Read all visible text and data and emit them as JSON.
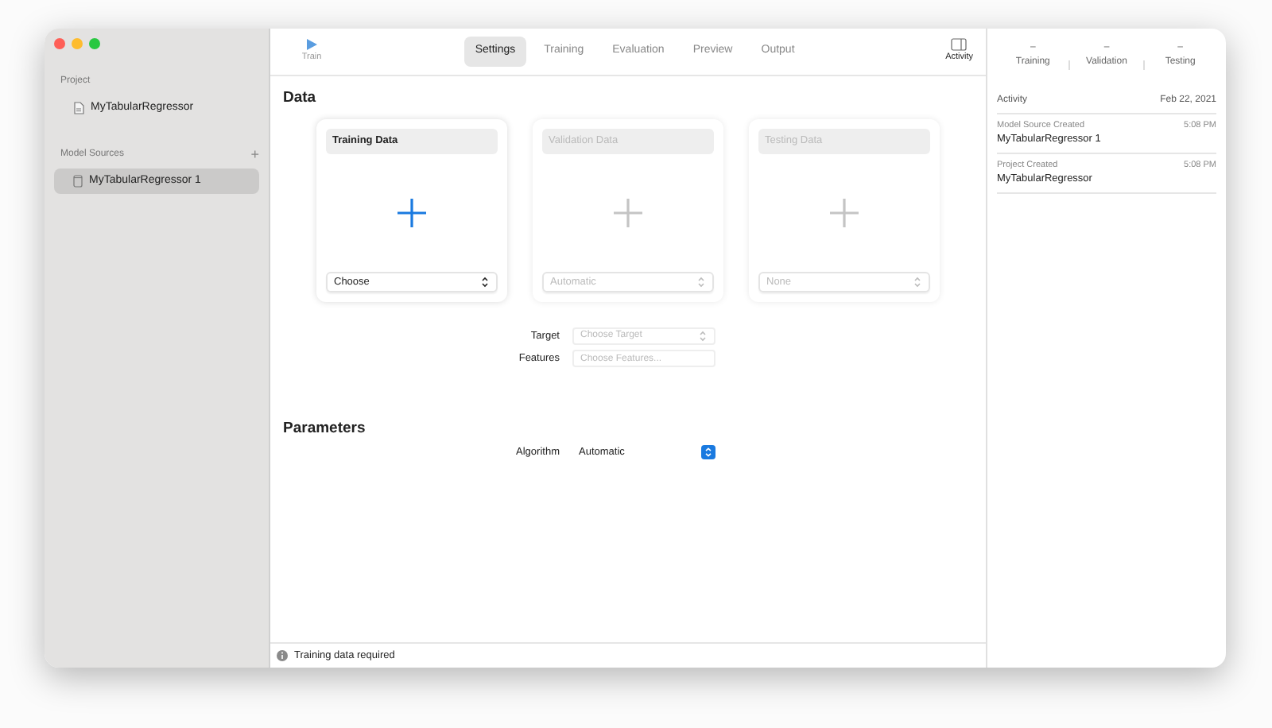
{
  "sidebar": {
    "sections": [
      {
        "title": "Project",
        "items": [
          {
            "label": "MyTabularRegressor",
            "kind": "project",
            "selected": false
          }
        ]
      },
      {
        "title": "Model Sources",
        "add_button": "+",
        "items": [
          {
            "label": "MyTabularRegressor 1",
            "kind": "source",
            "selected": true
          }
        ]
      }
    ]
  },
  "toolbar": {
    "train_button": {
      "label": "Train"
    },
    "tabs": [
      {
        "label": "Settings",
        "selected": true
      },
      {
        "label": "Training",
        "selected": false
      },
      {
        "label": "Evaluation",
        "selected": false
      },
      {
        "label": "Preview",
        "selected": false
      },
      {
        "label": "Output",
        "selected": false
      }
    ],
    "activity_button": {
      "label": "Activity"
    }
  },
  "data": {
    "title": "Data",
    "cards": [
      {
        "title": "Training Data",
        "enabled": true,
        "dropdown": "Choose"
      },
      {
        "title": "Validation Data",
        "enabled": false,
        "dropdown": "Automatic"
      },
      {
        "title": "Testing Data",
        "enabled": false,
        "dropdown": "None"
      }
    ],
    "fields": [
      {
        "label": "Target",
        "kind": "popup",
        "placeholder": "Choose Target"
      },
      {
        "label": "Features",
        "kind": "tokens",
        "placeholder": "Choose Features..."
      }
    ]
  },
  "parameters": {
    "title": "Parameters",
    "rows": [
      {
        "label": "Algorithm",
        "value": "Automatic"
      }
    ]
  },
  "status_bar": {
    "text": "Training data required"
  },
  "inspector": {
    "counts": [
      {
        "value": "–",
        "label": "Training"
      },
      {
        "value": "–",
        "label": "Validation"
      },
      {
        "value": "–",
        "label": "Testing"
      }
    ],
    "activity": {
      "title": "Activity",
      "date": "Feb 22, 2021",
      "entries": [
        {
          "event": "Model Source Created",
          "time": "5:08 PM",
          "name": "MyTabularRegressor 1"
        },
        {
          "event": "Project Created",
          "time": "5:08 PM",
          "name": "MyTabularRegressor"
        }
      ]
    }
  }
}
